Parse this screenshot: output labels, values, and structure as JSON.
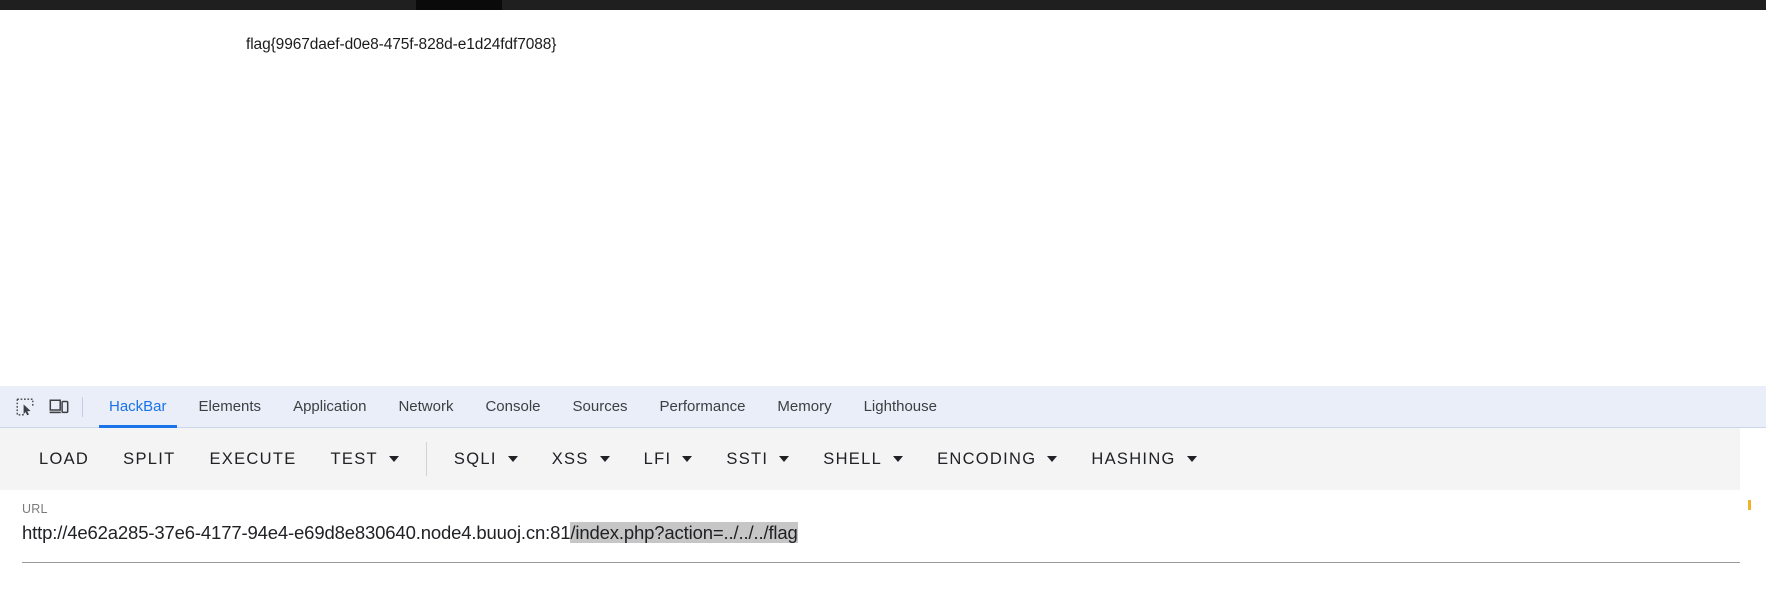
{
  "browser": {
    "chrome_strip_color": "#1f1f1f",
    "active_tab_notch_color": "#0a0a0a"
  },
  "page": {
    "flag_text": "flag{9967daef-d0e8-475f-828d-e1d24fdf7088}"
  },
  "devtools": {
    "accent_color": "#1a73e8",
    "tabbar_background": "#eaeef8",
    "icons": [
      {
        "name": "inspect-element-icon",
        "title": "Inspect element"
      },
      {
        "name": "device-toolbar-icon",
        "title": "Toggle device toolbar"
      }
    ],
    "tabs": [
      {
        "label": "HackBar",
        "active": true
      },
      {
        "label": "Elements",
        "active": false
      },
      {
        "label": "Application",
        "active": false
      },
      {
        "label": "Network",
        "active": false
      },
      {
        "label": "Console",
        "active": false
      },
      {
        "label": "Sources",
        "active": false
      },
      {
        "label": "Performance",
        "active": false
      },
      {
        "label": "Memory",
        "active": false
      },
      {
        "label": "Lighthouse",
        "active": false
      }
    ]
  },
  "hackbar": {
    "toolbar": [
      {
        "label": "LOAD",
        "dropdown": false,
        "separator_before": false
      },
      {
        "label": "SPLIT",
        "dropdown": false,
        "separator_before": false
      },
      {
        "label": "EXECUTE",
        "dropdown": false,
        "separator_before": false
      },
      {
        "label": "TEST",
        "dropdown": true,
        "separator_before": false
      },
      {
        "label": "SQLI",
        "dropdown": true,
        "separator_before": true
      },
      {
        "label": "XSS",
        "dropdown": true,
        "separator_before": false
      },
      {
        "label": "LFI",
        "dropdown": true,
        "separator_before": false
      },
      {
        "label": "SSTI",
        "dropdown": true,
        "separator_before": false
      },
      {
        "label": "SHELL",
        "dropdown": true,
        "separator_before": false
      },
      {
        "label": "ENCODING",
        "dropdown": true,
        "separator_before": false
      },
      {
        "label": "HASHING",
        "dropdown": true,
        "separator_before": false
      }
    ],
    "url_field": {
      "label": "URL",
      "value": "http://4e62a285-37e6-4177-94e4-e69d8e830640.node4.buuoj.cn:81/index.php?action=../../../flag",
      "unselected_part": "http://4e62a285-37e6-4177-94e4-e69d8e830640.node4.buuoj.cn:81",
      "selected_part": "/index.php?action=../../../flag",
      "selection_color": "#c6c6c6"
    }
  }
}
